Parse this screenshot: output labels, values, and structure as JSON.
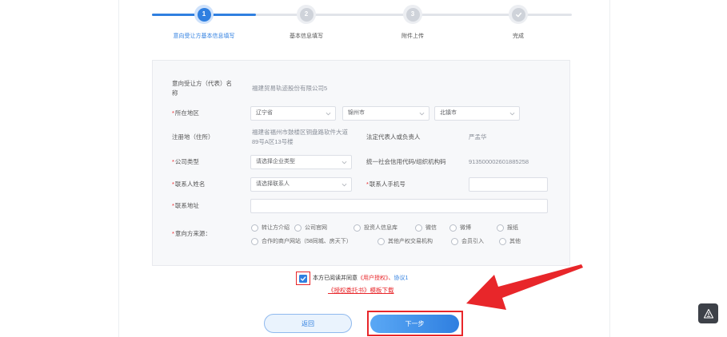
{
  "current_step": 1,
  "steps": [
    {
      "num": "1",
      "label": "意向受让方基本信息填写"
    },
    {
      "num": "2",
      "label": "基本信息填写"
    },
    {
      "num": "3",
      "label": "附件上传"
    },
    {
      "num": "",
      "label": "完成",
      "icon": "check-icon"
    }
  ],
  "required_mark": "*",
  "form": {
    "name": {
      "label": "意向受让方（代表）名称",
      "value": "福建贸易轨迹股份有限公司5"
    },
    "region": {
      "label": "所在地区",
      "province": "辽宁省",
      "city": "锦州市",
      "district": "北镇市"
    },
    "address": {
      "label": "注册地（住所）",
      "value": "福建省福州市鼓楼区铜盘路软件大道89号A区13号楼"
    },
    "legal_rep": {
      "label": "法定代表人或负责人",
      "value": "严孟华"
    },
    "company_type": {
      "label": "公司类型",
      "value": "请选择企业类型"
    },
    "credit_code": {
      "label": "统一社会信用代码/组织机构码",
      "value": "913500002601885258"
    },
    "contact_name": {
      "label": "联系人姓名",
      "value": "请选择联系人"
    },
    "contact_phone": {
      "label": "联系人手机号",
      "value": ""
    },
    "contact_address": {
      "label": "联系地址",
      "value": ""
    },
    "source": {
      "label": "意向方来源：",
      "options": [
        "转让方介绍",
        "公司官网",
        "投资人信息库",
        "微信",
        "微博",
        "报纸",
        "合作的商户网站（58同城、房天下）",
        "其他产权交易机构",
        "会员引入",
        "其他"
      ]
    }
  },
  "agreement": {
    "checked": true,
    "prefix": "本方已阅读并同意",
    "link_user_auth": "《用户授权》、",
    "link_protocol": "协议1",
    "template_link": "《授权委托书》模板下载"
  },
  "buttons": {
    "back": "返回",
    "next": "下一步"
  },
  "float_button": {
    "icon": "alert-icon"
  },
  "colors": {
    "primary": "#2f7fe0",
    "highlight": "#e8262a"
  }
}
